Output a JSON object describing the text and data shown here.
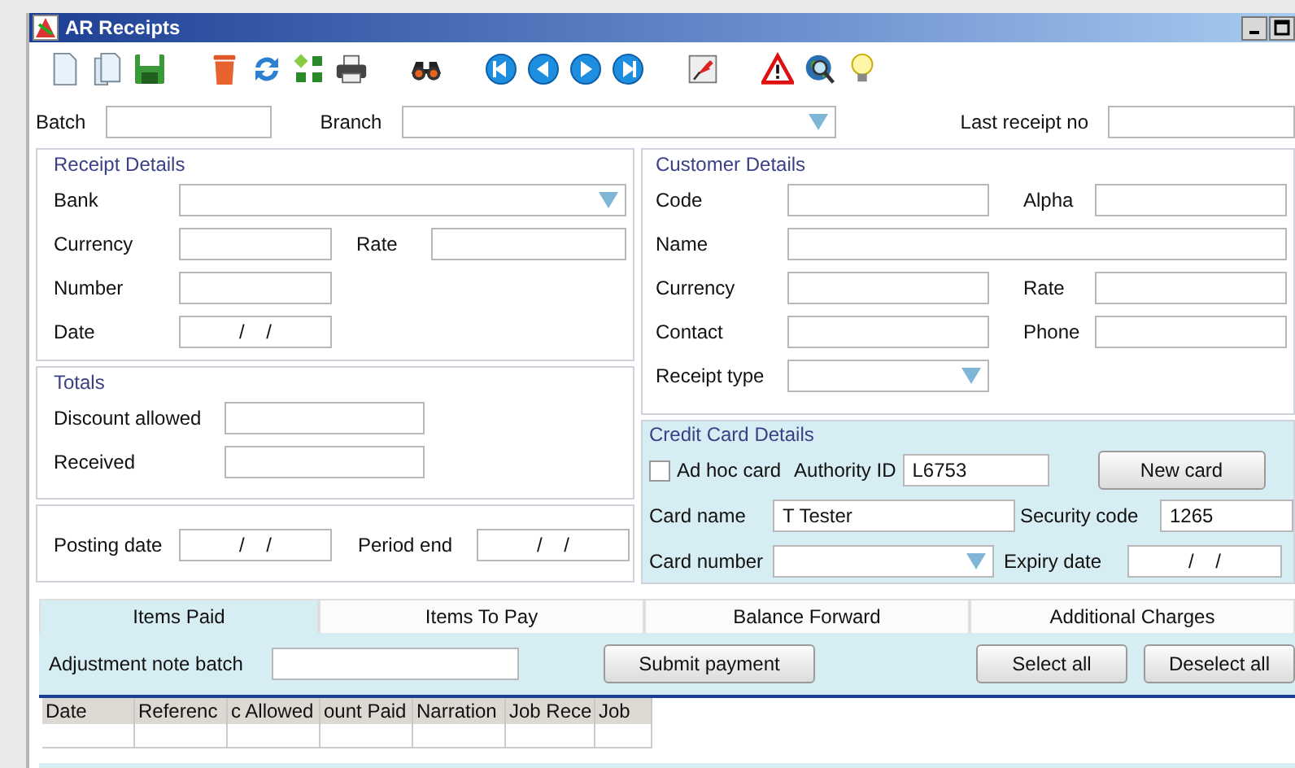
{
  "window": {
    "title": "AR Receipts"
  },
  "toolbar": [
    {
      "kind": "new"
    },
    {
      "kind": "copy"
    },
    {
      "kind": "save"
    },
    {
      "kind": "gap"
    },
    {
      "kind": "trash"
    },
    {
      "kind": "refresh"
    },
    {
      "kind": "grid"
    },
    {
      "kind": "print"
    },
    {
      "kind": "gap"
    },
    {
      "kind": "find"
    },
    {
      "kind": "gap"
    },
    {
      "kind": "first"
    },
    {
      "kind": "prev"
    },
    {
      "kind": "next"
    },
    {
      "kind": "last"
    },
    {
      "kind": "gap"
    },
    {
      "kind": "pin"
    },
    {
      "kind": "gap"
    },
    {
      "kind": "warning"
    },
    {
      "kind": "globe"
    },
    {
      "kind": "bulb"
    }
  ],
  "header": {
    "batch": "Batch",
    "branch": "Branch",
    "last_receipt_no": "Last receipt no"
  },
  "receipt_details": {
    "title": "Receipt Details",
    "bank": "Bank",
    "currency": "Currency",
    "rate": "Rate",
    "number": "Number",
    "date": "Date",
    "date_value": "/    /"
  },
  "totals": {
    "title": "Totals",
    "discount_allowed": "Discount allowed",
    "received": "Received"
  },
  "posting": {
    "posting_date": "Posting date",
    "posting_value": "/    /",
    "period_end": "Period end",
    "period_value": "/    /"
  },
  "customer_details": {
    "title": "Customer Details",
    "code": "Code",
    "alpha": "Alpha",
    "name": "Name",
    "currency": "Currency",
    "rate": "Rate",
    "contact": "Contact",
    "phone": "Phone",
    "receipt_type": "Receipt type"
  },
  "credit_card": {
    "title": "Credit Card Details",
    "ad_hoc_card": {
      "label": "Ad hoc card",
      "checked": false
    },
    "authority_id": {
      "label": "Authority ID",
      "value": "L6753"
    },
    "new_card": "New card",
    "card_name": {
      "label": "Card name",
      "value": "T Tester"
    },
    "security_code": {
      "label": "Security code",
      "value": "1265"
    },
    "card_number": "Card number",
    "expiry_date": {
      "label": "Expiry date",
      "value": "/    /"
    }
  },
  "tabs": [
    {
      "label": "Items Paid",
      "selected": true
    },
    {
      "label": "Items To Pay",
      "selected": false
    },
    {
      "label": "Balance Forward",
      "selected": false
    },
    {
      "label": "Additional Charges",
      "selected": false
    }
  ],
  "adjustment_note_batch": "Adjustment note batch",
  "buttons": [
    "Submit payment",
    "Select all",
    "Deselect all"
  ],
  "table": {
    "columns": [
      "Date",
      "Referenc",
      "c Allowed",
      "ount Paid",
      "Narration",
      "Job Rece",
      "Job"
    ]
  }
}
